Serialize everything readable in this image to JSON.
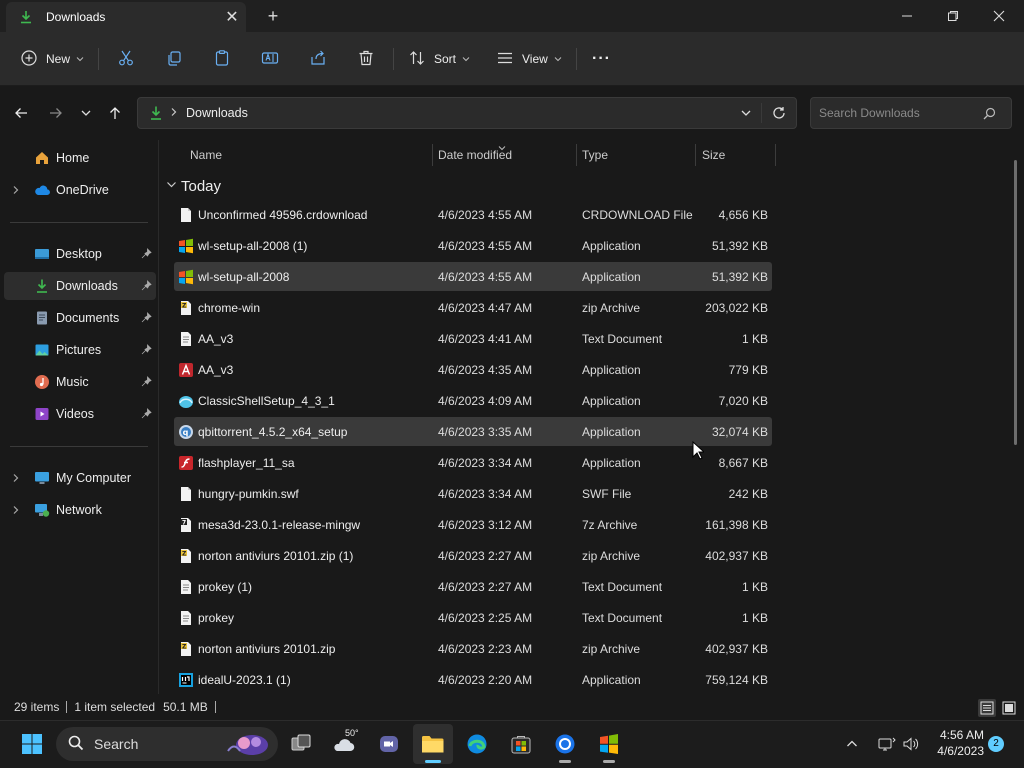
{
  "window": {
    "tab_title": "Downloads",
    "tab_close": "✕",
    "new_tab": "+"
  },
  "commandbar": {
    "new_label": "New",
    "sort_label": "Sort",
    "view_label": "View",
    "more_label": "···"
  },
  "address": {
    "location": "Downloads",
    "search_placeholder": "Search Downloads"
  },
  "sidebar": {
    "items": [
      {
        "label": "Home",
        "icon": "home-icon",
        "pinned": false
      },
      {
        "label": "OneDrive",
        "icon": "cloud-icon",
        "pinned": false
      },
      {
        "label": "Desktop",
        "icon": "desktop-icon",
        "pinned": true
      },
      {
        "label": "Downloads",
        "icon": "download-icon",
        "pinned": true
      },
      {
        "label": "Documents",
        "icon": "documents-icon",
        "pinned": true
      },
      {
        "label": "Pictures",
        "icon": "pictures-icon",
        "pinned": true
      },
      {
        "label": "Music",
        "icon": "music-icon",
        "pinned": true
      },
      {
        "label": "Videos",
        "icon": "videos-icon",
        "pinned": true
      },
      {
        "label": "My Computer",
        "icon": "computer-icon",
        "pinned": false
      },
      {
        "label": "Network",
        "icon": "network-icon",
        "pinned": false
      }
    ]
  },
  "columns": {
    "name": "Name",
    "date": "Date modified",
    "type": "Type",
    "size": "Size"
  },
  "group": {
    "label": "Today"
  },
  "files": [
    {
      "name": "Unconfirmed 49596.crdownload",
      "date": "4/6/2023 4:55 AM",
      "type": "CRDOWNLOAD File",
      "size": "4,656 KB",
      "icon": "blank-file-icon"
    },
    {
      "name": "wl-setup-all-2008 (1)",
      "date": "4/6/2023 4:55 AM",
      "type": "Application",
      "size": "51,392 KB",
      "icon": "windows-logo-icon"
    },
    {
      "name": "wl-setup-all-2008",
      "date": "4/6/2023 4:55 AM",
      "type": "Application",
      "size": "51,392 KB",
      "icon": "windows-logo-icon"
    },
    {
      "name": "chrome-win",
      "date": "4/6/2023 4:47 AM",
      "type": "zip Archive",
      "size": "203,022 KB",
      "icon": "zip-archive-icon"
    },
    {
      "name": "AA_v3",
      "date": "4/6/2023 4:41 AM",
      "type": "Text Document",
      "size": "1 KB",
      "icon": "text-file-icon"
    },
    {
      "name": "AA_v3",
      "date": "4/6/2023 4:35 AM",
      "type": "Application",
      "size": "779 KB",
      "icon": "ammyy-admin-icon"
    },
    {
      "name": "ClassicShellSetup_4_3_1",
      "date": "4/6/2023 4:09 AM",
      "type": "Application",
      "size": "7,020 KB",
      "icon": "classic-shell-icon"
    },
    {
      "name": "qbittorrent_4.5.2_x64_setup",
      "date": "4/6/2023 3:35 AM",
      "type": "Application",
      "size": "32,074 KB",
      "icon": "qbittorrent-icon"
    },
    {
      "name": "flashplayer_11_sa",
      "date": "4/6/2023 3:34 AM",
      "type": "Application",
      "size": "8,667 KB",
      "icon": "flash-player-icon"
    },
    {
      "name": "hungry-pumkin.swf",
      "date": "4/6/2023 3:34 AM",
      "type": "SWF File",
      "size": "242 KB",
      "icon": "blank-file-icon"
    },
    {
      "name": "mesa3d-23.0.1-release-mingw",
      "date": "4/6/2023 3:12 AM",
      "type": "7z Archive",
      "size": "161,398 KB",
      "icon": "7z-archive-icon"
    },
    {
      "name": "norton antiviurs 20101.zip (1)",
      "date": "4/6/2023 2:27 AM",
      "type": "zip Archive",
      "size": "402,937 KB",
      "icon": "zip-archive-icon"
    },
    {
      "name": "prokey (1)",
      "date": "4/6/2023 2:27 AM",
      "type": "Text Document",
      "size": "1 KB",
      "icon": "text-file-icon"
    },
    {
      "name": "prokey",
      "date": "4/6/2023 2:25 AM",
      "type": "Text Document",
      "size": "1 KB",
      "icon": "text-file-icon"
    },
    {
      "name": "norton antiviurs 20101.zip",
      "date": "4/6/2023 2:23 AM",
      "type": "zip Archive",
      "size": "402,937 KB",
      "icon": "zip-archive-icon"
    },
    {
      "name": "idealU-2023.1 (1)",
      "date": "4/6/2023 2:20 AM",
      "type": "Application",
      "size": "759,124 KB",
      "icon": "intellij-idea-icon"
    }
  ],
  "status": {
    "items": "29 items",
    "selection": "1 item selected",
    "selection_size": "50.1 MB"
  },
  "taskbar": {
    "search_label": "Search",
    "weather_temp": "50°",
    "time": "4:56 AM",
    "date": "4/6/2023",
    "notification_count": "2"
  },
  "colors": {
    "accent": "#60cdff",
    "folder_green": "#3fb950",
    "background": "#191919"
  }
}
